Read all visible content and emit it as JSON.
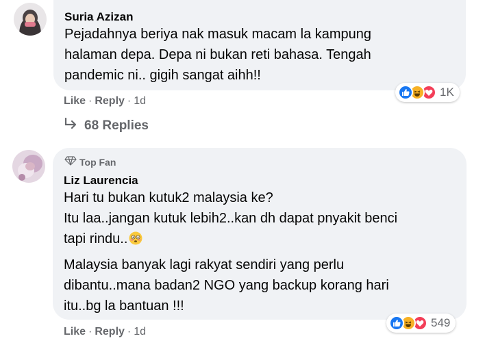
{
  "comments": [
    {
      "author": "Suria Azizan",
      "text_lines": [
        "Pejadahnya beriya nak masuk macam la kampung",
        "halaman depa. Depa ni bukan reti bahasa. Tengah",
        "pandemic ni.. gigih sangat aihh!!"
      ],
      "reaction_count": "1K",
      "actions": {
        "like": "Like",
        "reply": "Reply",
        "time": "1d"
      },
      "replies_label": "68 Replies"
    },
    {
      "badge": "Top Fan",
      "author": "Liz Laurencia",
      "paragraph1_lines": [
        "Hari tu bukan kutuk2 malaysia ke?",
        "Itu laa..jangan kutuk lebih2..kan dh dapat pnyakit benci",
        "tapi rindu.."
      ],
      "paragraph2_lines": [
        "Malaysia banyak lagi rakyat sendiri yang perlu",
        "dibantu..mana badan2 NGO yang backup korang hari",
        "itu..bg la bantuan !!!"
      ],
      "reaction_count": "549",
      "actions": {
        "like": "Like",
        "reply": "Reply",
        "time": "1d"
      }
    }
  ],
  "separator": "·",
  "colors": {
    "bubble": "#f0f2f5",
    "secondary_text": "#65676b",
    "like_blue": "#1877f2",
    "haha_yellow": "#f7b125",
    "love_red": "#f33e58"
  },
  "icons": {
    "reactions": [
      "like-icon",
      "haha-icon",
      "love-icon"
    ],
    "reply_arrow": "reply-arrow-icon",
    "top_fan": "diamond-icon",
    "inline_emoji": "flushed-face-emoji"
  }
}
